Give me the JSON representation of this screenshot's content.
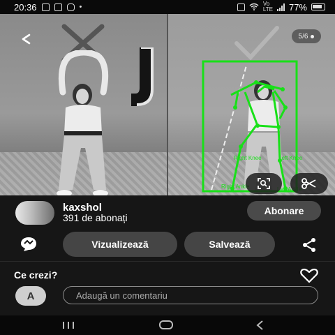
{
  "status_bar": {
    "time": "20:36",
    "battery": "77%"
  },
  "media": {
    "page_indicator": "5/6",
    "pose_labels": [
      "Right Knee",
      "Left Knee",
      "Right Ankle",
      "Left Ankle"
    ]
  },
  "profile": {
    "username": "kaxshol",
    "subscribers": "391 de abonați",
    "follow_label": "Abonare"
  },
  "actions": {
    "view_label": "Vizualizează",
    "save_label": "Salvează"
  },
  "comments": {
    "prompt": "Ce crezi?",
    "avatar_initial": "A",
    "input_placeholder": "Adaugă un comentariu"
  },
  "icons": [
    "back-icon",
    "check-icon",
    "x-mark-icon",
    "lens-search-icon",
    "scissors-icon",
    "message-icon",
    "share-icon",
    "heart-icon",
    "recent-apps-icon",
    "home-icon",
    "nav-back-icon"
  ],
  "colors": {
    "skeleton": "#18e018",
    "button": "#454545",
    "background": "#161616"
  }
}
